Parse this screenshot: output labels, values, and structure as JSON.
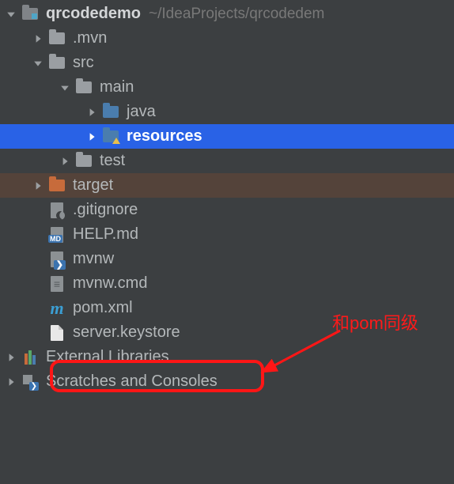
{
  "project": {
    "name": "qrcodedemo",
    "path_hint": "~/IdeaProjects/qrcodedem"
  },
  "tree": {
    "mvn": ".mvn",
    "src": "src",
    "main": "main",
    "java": "java",
    "resources": "resources",
    "test": "test",
    "target": "target",
    "gitignore": ".gitignore",
    "help": "HELP.md",
    "mvnw": "mvnw",
    "mvnw_cmd": "mvnw.cmd",
    "pom": "pom.xml",
    "keystore": "server.keystore"
  },
  "roots": {
    "external_libs": "External Libraries",
    "scratches": "Scratches and Consoles"
  },
  "annotation": {
    "text": "和pom同级"
  }
}
